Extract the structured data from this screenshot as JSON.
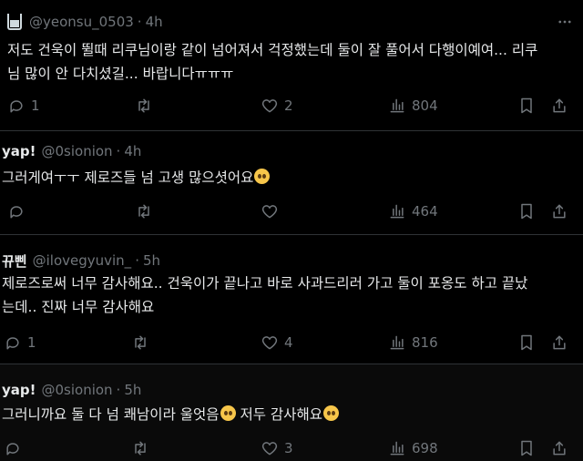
{
  "tweets": [
    {
      "name": "",
      "handle": "@yeonsu_0503",
      "time": "4h",
      "text_lines": [
        "저도 건욱이 뛸때 리쿠님이랑 같이 넘어져서 걱정했는데 둘이 잘 풀어서 다행이예여... 리쿠",
        "님 많이 안 다치셨길... 바랍니다ㅠㅠㅠ"
      ],
      "replies": "1",
      "retweets": "",
      "likes": "2",
      "views": "804"
    },
    {
      "name": "yap!",
      "handle": "@0sionion",
      "time": "4h",
      "text_lines": [
        "그러게여ㅜㅜ 제로즈들 넘 고생 많으셧어요"
      ],
      "replies": "",
      "retweets": "",
      "likes": "",
      "views": "464"
    },
    {
      "name": "뀨삔",
      "handle": "@ilovegyuvin_",
      "time": "5h",
      "text_lines": [
        "제로즈로써 너무 감사해요.. 건욱이가 끝나고 바로 사과드리러 가고 둘이 포옹도 하고 끝났",
        "는데.. 진짜 너무 감사해요"
      ],
      "replies": "1",
      "retweets": "",
      "likes": "4",
      "views": "816"
    },
    {
      "name": "yap!",
      "handle": "@0sionion",
      "time": "5h",
      "text_before": "그러니까요 둘 다 넘 쾌남이라 울엇음",
      "text_after": " 저두 감사해요",
      "replies": "",
      "retweets": "",
      "likes": "3",
      "views": "698"
    }
  ],
  "icons": {
    "reply": "reply-icon",
    "retweet": "retweet-icon",
    "like": "heart-icon",
    "views": "views-icon",
    "bookmark": "bookmark-icon",
    "share": "share-icon",
    "more": "more-icon"
  },
  "colors": {
    "background": "#000000",
    "text": "#e7e9ea",
    "muted": "#71767b",
    "divider": "#2f3336"
  }
}
